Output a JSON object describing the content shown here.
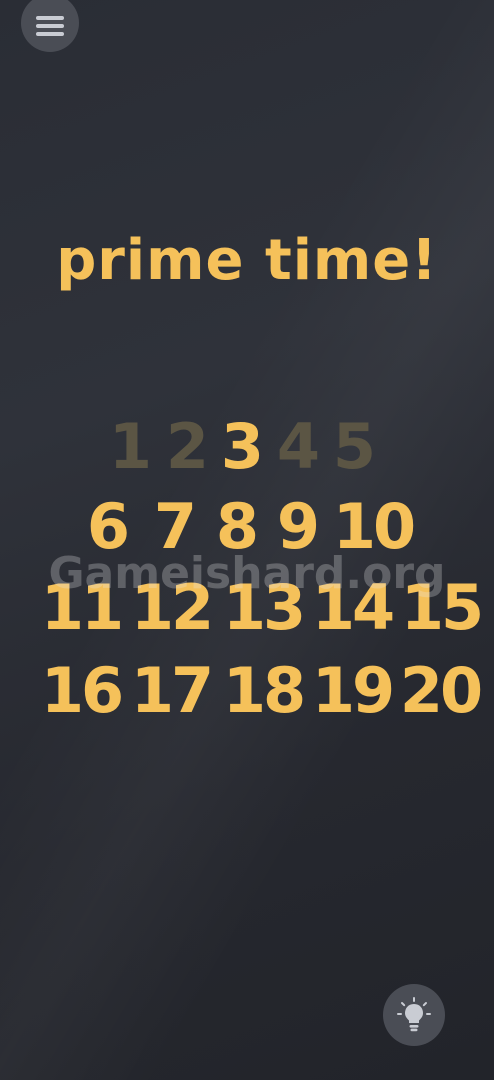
{
  "title": "prime time!",
  "watermark": "Gameishard.org",
  "icons": {
    "menu": "hamburger-menu-icon",
    "hint": "lightbulb-icon"
  },
  "colors": {
    "accent": "#f5c15a",
    "faded": "#5b5544",
    "button": "#4a4d55"
  },
  "numbers": [
    {
      "label": "1",
      "faded": true
    },
    {
      "label": "2",
      "faded": true
    },
    {
      "label": "3",
      "faded": false
    },
    {
      "label": "4",
      "faded": true
    },
    {
      "label": "5",
      "faded": true
    },
    {
      "label": "6",
      "faded": false
    },
    {
      "label": "7",
      "faded": false
    },
    {
      "label": "8",
      "faded": false
    },
    {
      "label": "9",
      "faded": false
    },
    {
      "label": "10",
      "faded": false
    },
    {
      "label": "11",
      "faded": false
    },
    {
      "label": "12",
      "faded": false
    },
    {
      "label": "13",
      "faded": false
    },
    {
      "label": "14",
      "faded": false
    },
    {
      "label": "15",
      "faded": false
    },
    {
      "label": "16",
      "faded": false
    },
    {
      "label": "17",
      "faded": false
    },
    {
      "label": "18",
      "faded": false
    },
    {
      "label": "19",
      "faded": false
    },
    {
      "label": "20",
      "faded": false
    }
  ]
}
